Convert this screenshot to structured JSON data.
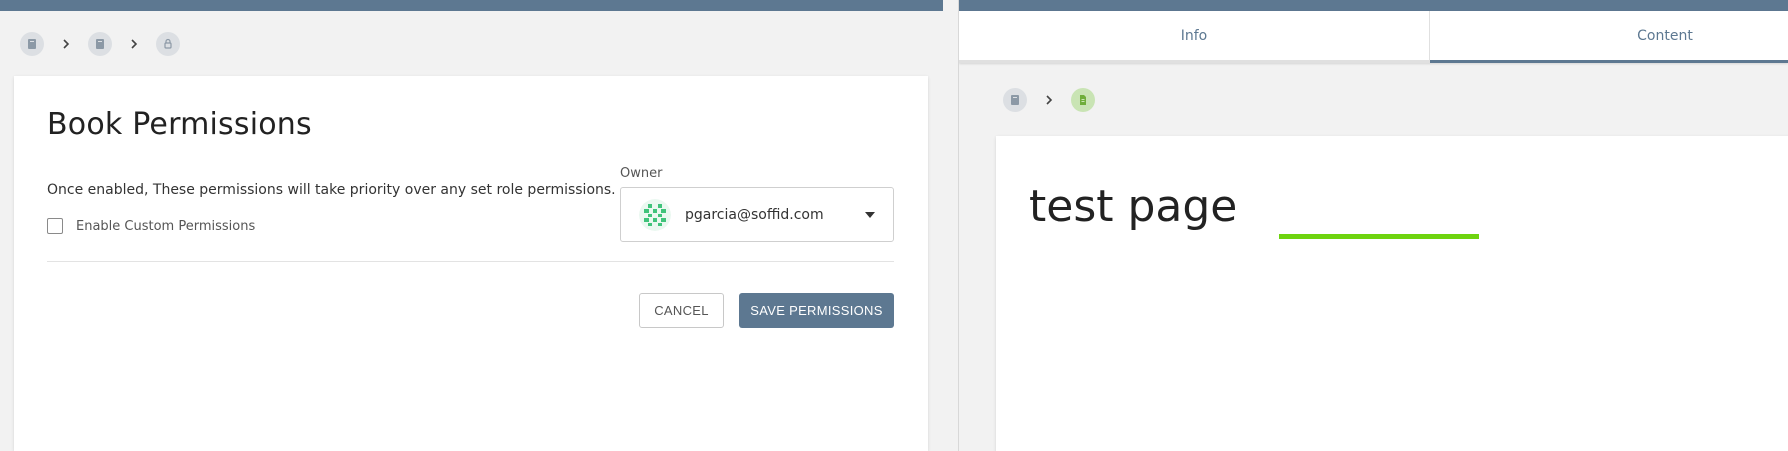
{
  "left_panel": {
    "breadcrumb": {
      "items": [
        {
          "icon": "book-icon"
        },
        {
          "icon": "book-icon"
        },
        {
          "icon": "lock-icon"
        }
      ],
      "separator_icon": "chevron-right-icon"
    },
    "card": {
      "title": "Book Permissions",
      "description": "Once enabled, These permissions will take priority over any set role permissions.",
      "enable_custom_label": "Enable Custom Permissions",
      "enable_custom_checked": false,
      "owner": {
        "label": "Owner",
        "value": "pgarcia@soffid.com",
        "avatar_icon": "identicon-avatar"
      },
      "cancel_label": "CANCEL",
      "save_label": "SAVE PERMISSIONS"
    }
  },
  "right_panel": {
    "tabs": [
      {
        "label": "Info",
        "active": false
      },
      {
        "label": "Content",
        "active": true
      }
    ],
    "breadcrumb": {
      "items": [
        {
          "icon": "book-icon"
        },
        {
          "icon": "page-icon"
        }
      ],
      "separator_icon": "chevron-right-icon"
    },
    "page": {
      "title": "test page",
      "progress_icon": "loading-bar"
    }
  },
  "colors": {
    "brand": "#5d7891",
    "accent_green": "#6ed40f",
    "avatar_green": "#3fc37a",
    "background": "#f2f2f2"
  }
}
